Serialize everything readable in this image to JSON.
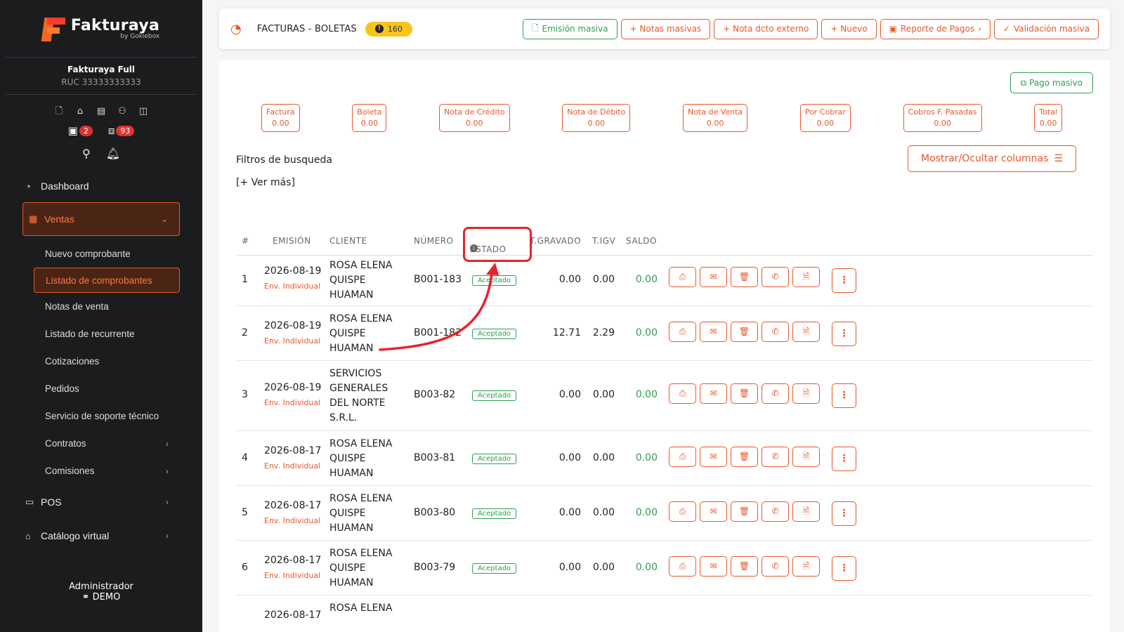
{
  "sidebar": {
    "logo": {
      "name": "Fakturaya",
      "tagline": "by Gokiebox"
    },
    "company": {
      "name": "Fakturaya Full",
      "ruc": "RUC 33333333333"
    },
    "badges": [
      {
        "icon": "calendar-x-icon",
        "count": "2"
      },
      {
        "icon": "boxes-icon",
        "count": "93"
      }
    ],
    "menu": {
      "dashboard": "Dashboard",
      "ventas": "Ventas",
      "subitems": [
        "Nuevo comprobante",
        "Listado de comprobantes",
        "Notas de venta",
        "Listado de recurrente",
        "Cotizaciones",
        "Pedidos",
        "Servicio de soporte técnico",
        "Contratos",
        "Comisiones"
      ],
      "pos": "POS",
      "catalogo": "Catálogo virtual"
    },
    "admin": {
      "role": "Administrador",
      "mode": "DEMO"
    }
  },
  "topbar": {
    "title": "FACTURAS - BOLETAS",
    "count": "160",
    "buttons": [
      "Emisión masiva",
      "+ Notas masivas",
      "+ Nota dcto externo",
      "+ Nuevo",
      "Reporte de Pagos",
      "Validación masiva"
    ]
  },
  "panel": {
    "pago_masivo": "Pago masivo",
    "totals": [
      {
        "label": "Factura",
        "value": "0.00"
      },
      {
        "label": "Boleta",
        "value": "0.00"
      },
      {
        "label": "Nota de Crédito",
        "value": "0.00"
      },
      {
        "label": "Nota de Débito",
        "value": "0.00"
      },
      {
        "label": "Nota de Venta",
        "value": "0.00"
      },
      {
        "label": "Por Cobrar",
        "value": "0.00"
      },
      {
        "label": "Cobros F. Pasadas",
        "value": "0.00"
      },
      {
        "label": "Total",
        "value": "0.00"
      }
    ],
    "filtros": "Filtros de busqueda",
    "ver_mas": "[+ Ver más]",
    "columnas_btn": "Mostrar/Ocultar columnas"
  },
  "table": {
    "headers": {
      "num": "#",
      "emision": "EMISIÓN",
      "cliente": "CLIENTE",
      "numero": "NÚMERO",
      "estado": "ESTADO",
      "gravado": "T.GRAVADO",
      "igv": "T.IGV",
      "saldo": "SALDO"
    },
    "rows": [
      {
        "n": "1",
        "date": "2026-08-19",
        "env": "Env. Individual",
        "client": "ROSA ELENA QUISPE HUAMAN",
        "number": "B001-183",
        "status": "Aceptado",
        "gravado": "0.00",
        "igv": "0.00",
        "saldo": "0.00"
      },
      {
        "n": "2",
        "date": "2026-08-19",
        "env": "Env. Individual",
        "client": "ROSA ELENA QUISPE HUAMAN",
        "number": "B001-182",
        "status": "Aceptado",
        "gravado": "12.71",
        "igv": "2.29",
        "saldo": "0.00"
      },
      {
        "n": "3",
        "date": "2026-08-19",
        "env": "Env. Individual",
        "client": "SERVICIOS GENERALES DEL NORTE S.R.L.",
        "number": "B003-82",
        "status": "Aceptado",
        "gravado": "0.00",
        "igv": "0.00",
        "saldo": "0.00"
      },
      {
        "n": "4",
        "date": "2026-08-17",
        "env": "Env. Individual",
        "client": "ROSA ELENA QUISPE HUAMAN",
        "number": "B003-81",
        "status": "Aceptado",
        "gravado": "0.00",
        "igv": "0.00",
        "saldo": "0.00"
      },
      {
        "n": "5",
        "date": "2026-08-17",
        "env": "Env. Individual",
        "client": "ROSA ELENA QUISPE HUAMAN",
        "number": "B003-80",
        "status": "Aceptado",
        "gravado": "0.00",
        "igv": "0.00",
        "saldo": "0.00"
      },
      {
        "n": "6",
        "date": "2026-08-17",
        "env": "Env. Individual",
        "client": "ROSA ELENA QUISPE HUAMAN",
        "number": "B003-79",
        "status": "Aceptado",
        "gravado": "0.00",
        "igv": "0.00",
        "saldo": "0.00"
      },
      {
        "n": "",
        "date": "2026-08-17",
        "env": "",
        "client": "ROSA ELENA",
        "number": "",
        "status": "",
        "gravado": "",
        "igv": "",
        "saldo": ""
      }
    ],
    "row_actions": [
      "printer-icon",
      "envelope-icon",
      "trash-icon",
      "whatsapp-icon",
      "file-pdf-icon",
      "more-vertical-icon"
    ]
  },
  "colors": {
    "accent": "#e8572a",
    "success": "#2e9e4f",
    "sidebar_bg": "#1b1c1e",
    "annotation": "#e8222a",
    "badge": "#f7c518"
  }
}
